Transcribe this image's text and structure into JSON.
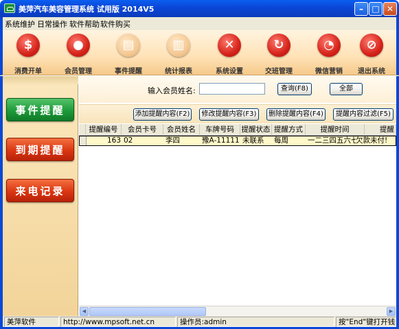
{
  "window": {
    "title": "美萍汽车美容管理系统 试用版  2014V5"
  },
  "menu": [
    "系统维护",
    "日常操作",
    "软件帮助",
    "软件购买"
  ],
  "toolbar": [
    {
      "label": "消费开单",
      "icon": "dollar-icon",
      "glyph": "$"
    },
    {
      "label": "会员管理",
      "icon": "member-icon",
      "glyph": "●"
    },
    {
      "label": "事件提醒",
      "icon": "book-icon",
      "glyph": "▤"
    },
    {
      "label": "统计报表",
      "icon": "chart-icon",
      "glyph": "▥"
    },
    {
      "label": "系统设置",
      "icon": "tools-icon",
      "glyph": "✕"
    },
    {
      "label": "交班管理",
      "icon": "refresh-icon",
      "glyph": "↻"
    },
    {
      "label": "微信营销",
      "icon": "wechat-icon",
      "glyph": "◔"
    },
    {
      "label": "退出系统",
      "icon": "exit-icon",
      "glyph": "⊘"
    }
  ],
  "left_nav": [
    "事件提醒",
    "到期提醒",
    "来电记录"
  ],
  "search": {
    "label": "输入会员姓名:",
    "value": "",
    "query_button": "查询(F8)",
    "all_button": "全部"
  },
  "actions": [
    "添加提醒内容(F2)",
    "修改提醒内容(F3)",
    "删除提醒内容(F4)",
    "提醒内容过滤(F5)"
  ],
  "grid": {
    "columns": [
      "提醒编号",
      "会员卡号",
      "会员姓名",
      "车牌号码",
      "提醒状态",
      "提醒方式",
      "提醒时间",
      "提醒"
    ],
    "rows": [
      [
        "163",
        "02",
        "李四",
        "豫A-11111",
        "未联系",
        "每周",
        "一二三四五六七",
        "欠款未付!"
      ]
    ]
  },
  "status": {
    "company": "美萍软件",
    "url": "http://www.mpsoft.net.cn",
    "operator": "操作员:admin",
    "hint": "按\"End\"键打开钱箱"
  },
  "colors": {
    "title_blue": "#0a48d8",
    "nav_green": "#1e9a3a",
    "nav_red": "#da3612",
    "row_highlight": "#fff8c9"
  }
}
